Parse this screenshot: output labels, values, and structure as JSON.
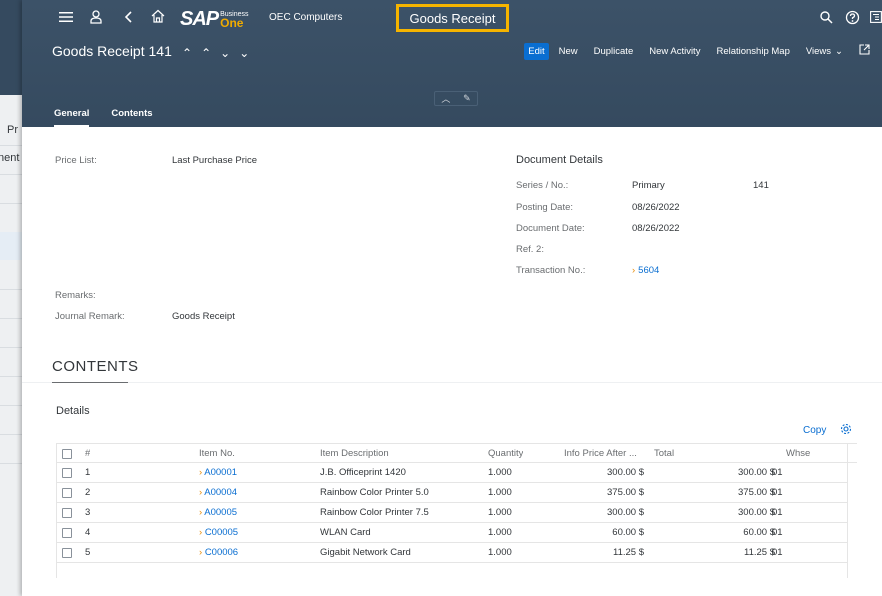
{
  "background": {
    "texts": [
      "Pr",
      "nent"
    ]
  },
  "shell": {
    "company": "OEC Computers",
    "app_title": "Goods Receipt",
    "logo_sap": "SAP",
    "logo_business": "Business",
    "logo_one": "One"
  },
  "object": {
    "title": "Goods Receipt 141",
    "actions": [
      "Edit",
      "New",
      "Duplicate",
      "New Activity",
      "Relationship Map",
      "Views"
    ]
  },
  "tabs": [
    "General",
    "Contents"
  ],
  "general": {
    "price_list_label": "Price List:",
    "price_list_value": "Last Purchase Price",
    "remarks_label": "Remarks:",
    "journal_remark_label": "Journal Remark:",
    "journal_remark_value": "Goods Receipt"
  },
  "document": {
    "header": "Document Details",
    "series_label": "Series / No.:",
    "series_value": "Primary",
    "series_number": "141",
    "posting_label": "Posting Date:",
    "posting_value": "08/26/2022",
    "docdate_label": "Document Date:",
    "docdate_value": "08/26/2022",
    "ref2_label": "Ref. 2:",
    "transno_label": "Transaction No.:",
    "transno_value": "5604"
  },
  "contents": {
    "section_title": "CONTENTS",
    "details_label": "Details",
    "copy_label": "Copy",
    "columns": [
      "#",
      "Item No.",
      "Item Description",
      "Quantity",
      "Info Price After ...",
      "Total",
      "Whse"
    ],
    "rows": [
      {
        "n": "1",
        "item": "A00001",
        "desc": "J.B. Officeprint 1420",
        "qty": "1.000",
        "price": "300.00 $",
        "total": "300.00 $",
        "whse": "01"
      },
      {
        "n": "2",
        "item": "A00004",
        "desc": "Rainbow Color Printer 5.0",
        "qty": "1.000",
        "price": "375.00 $",
        "total": "375.00 $",
        "whse": "01"
      },
      {
        "n": "3",
        "item": "A00005",
        "desc": "Rainbow Color Printer 7.5",
        "qty": "1.000",
        "price": "300.00 $",
        "total": "300.00 $",
        "whse": "01"
      },
      {
        "n": "4",
        "item": "C00005",
        "desc": "WLAN Card",
        "qty": "1.000",
        "price": "60.00 $",
        "total": "60.00 $",
        "whse": "01"
      },
      {
        "n": "5",
        "item": "C00006",
        "desc": "Gigabit Network Card",
        "qty": "1.000",
        "price": "11.25 $",
        "total": "11.25 $",
        "whse": "01"
      }
    ]
  },
  "colors": {
    "shell_bg": "#354a5f",
    "accent": "#0a6ed1",
    "highlight": "#f5b400",
    "link_chevron": "#e78c07"
  }
}
